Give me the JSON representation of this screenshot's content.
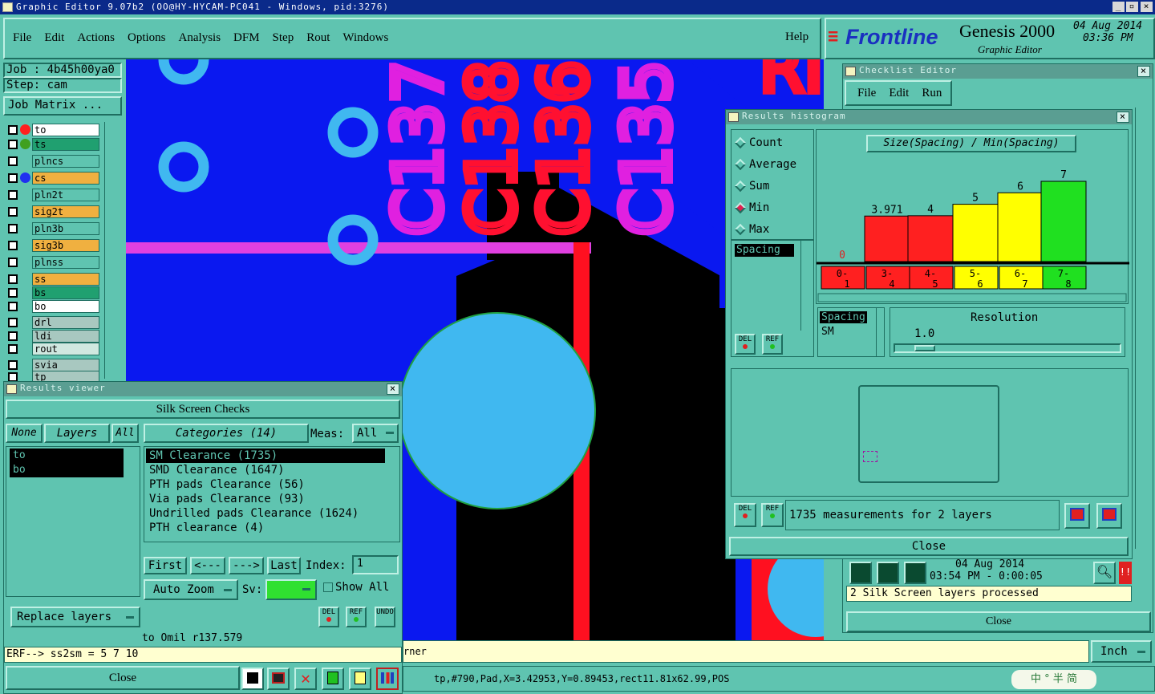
{
  "window": {
    "title": "Graphic Editor 9.07b2 (OO@HY-HYCAM-PC041 - Windows, pid:3276)"
  },
  "menu": [
    "File",
    "Edit",
    "Actions",
    "Options",
    "Analysis",
    "DFM",
    "Step",
    "Rout",
    "Windows"
  ],
  "help": "Help",
  "brand": {
    "logo": "Frontline",
    "product": "Genesis 2000",
    "sub": "Graphic Editor",
    "date": "04 Aug 2014",
    "time": "03:36 PM"
  },
  "job": {
    "job": "Job : 4b45h00ya0",
    "step": "Step: cam",
    "matrix": "Job Matrix ..."
  },
  "layers": [
    {
      "name": "to",
      "color": "#ffffff"
    },
    {
      "name": "ts",
      "color": "#20a070"
    },
    {
      "name": "plncs",
      "color": "#5fc4b0"
    },
    {
      "name": "cs",
      "color": "#f0b040"
    },
    {
      "name": "pln2t",
      "color": "#5fc4b0"
    },
    {
      "name": "sig2t",
      "color": "#f0b040"
    },
    {
      "name": "pln3b",
      "color": "#5fc4b0"
    },
    {
      "name": "sig3b",
      "color": "#f0b040"
    },
    {
      "name": "plnss",
      "color": "#5fc4b0"
    },
    {
      "name": "ss",
      "color": "#f0b040"
    },
    {
      "name": "bs",
      "color": "#20a070"
    },
    {
      "name": "bo",
      "color": "#ffffff"
    },
    {
      "name": "drl",
      "color": "#a8c8c0"
    },
    {
      "name": "ldi",
      "color": "#a8c8c0"
    },
    {
      "name": "rout",
      "color": "#d0e8e0"
    },
    {
      "name": "svia",
      "color": "#a8c8c0"
    },
    {
      "name": "tp",
      "color": "#a8c8c0"
    }
  ],
  "canvas": {
    "texts": [
      "C137",
      "C138",
      "C136",
      "C135"
    ],
    "partial": "RI"
  },
  "results_viewer": {
    "title": "Results viewer",
    "header": "Silk Screen Checks",
    "none": "None",
    "layers": "Layers",
    "all": "All",
    "layer_list": [
      "to",
      "bo"
    ],
    "categories": "Categories (14)",
    "meas": "Meas:",
    "meas_val": "All",
    "cat_list": [
      "SM Clearance (1735)",
      "SMD Clearance (1647)",
      "PTH pads Clearance (56)",
      "Via pads Clearance (93)",
      "Undrilled pads Clearance (1624)",
      "PTH clearance (4)"
    ],
    "first": "First",
    "prev": "<---",
    "next": "--->",
    "last": "Last",
    "index": "Index:",
    "index_val": "1",
    "autozoom": "Auto Zoom",
    "sv": "Sv:",
    "showall": "Show All",
    "replace": "Replace layers",
    "status1": "to Omil  r137.579",
    "status2": "ERF--> ss2sm = 5 7 10",
    "close": "Close",
    "del": "DEL",
    "ref": "REF",
    "undo": "UNDO"
  },
  "histogram": {
    "title": "Results histogram",
    "opts": [
      "Count",
      "Average",
      "Sum",
      "Min",
      "Max"
    ],
    "chart_title": "Size(Spacing) / Min(Spacing)",
    "listitem": "Spacing",
    "sel1": "Spacing",
    "sel2": "SM",
    "resolution": "Resolution",
    "res_val": "1.0",
    "measurements": "1735 measurements for 2 layers",
    "close": "Close"
  },
  "chart_data": {
    "type": "bar",
    "title": "Size(Spacing) / Min(Spacing)",
    "categories": [
      "0-1",
      "3-4",
      "4-5",
      "5-6",
      "6-7",
      "7-8"
    ],
    "values": [
      0,
      3.971,
      4,
      5,
      6,
      7
    ],
    "value_labels": [
      "0",
      "3.971",
      "4",
      "5",
      "6",
      "7"
    ],
    "colors": [
      "#ff2020",
      "#ff2020",
      "#ff2020",
      "#ffff00",
      "#ffff00",
      "#20e020"
    ]
  },
  "checklist": {
    "title": "Checklist Editor",
    "menu": [
      "File",
      "Edit",
      "Run"
    ],
    "date": "04 Aug 2014",
    "time": "03:54 PM - 0:00:05",
    "msg": "2 Silk Screen layers processed",
    "close": "Close"
  },
  "bottom": {
    "corner": "rner",
    "inch": "Inch",
    "coords": "tp,#790,Pad,X=3.42953,Y=0.89453,rect11.81x62.99,POS",
    "ime": "中 ° 半 简"
  }
}
